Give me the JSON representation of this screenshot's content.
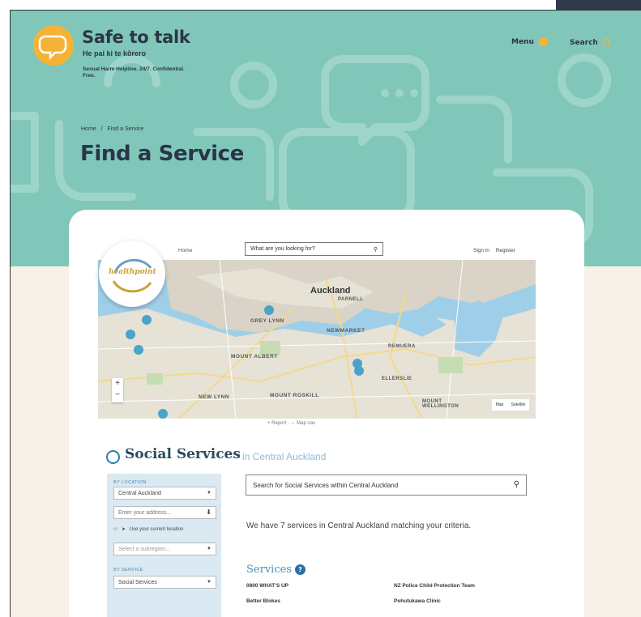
{
  "brand": {
    "name": "Safe to talk",
    "sub": "He pai ki te kōrero",
    "tagline": "Sexual Harm Helpline. 24/7. Confidential. Free."
  },
  "nav": {
    "menu_label": "Menu",
    "search_label": "Search"
  },
  "breadcrumb": {
    "home": "Home",
    "sep": "/",
    "current": "Find a Service"
  },
  "page_title": "Find a Service",
  "healthpoint": {
    "logo_text": "healthpoint",
    "home": "Home",
    "search_placeholder": "What are you looking for?",
    "sign_in": "Sign in",
    "register": "Register",
    "below_map": "+ Report · ⇔ Map nav"
  },
  "map": {
    "labels": [
      "Auckland",
      "PARNELL",
      "GREY LYNN",
      "NEWMARKET",
      "REMUERA",
      "MOUNT ALBERT",
      "ELLERSLIE",
      "NEW LYNN",
      "MOUNT ROSKILL",
      "MOUNT WELLINGTON"
    ],
    "zoom_in": "+",
    "zoom_out": "−",
    "map_btn": "Map",
    "satellite_btn": "Satellite"
  },
  "section": {
    "title": "Social Services",
    "location": "in Central Auckland"
  },
  "filters": {
    "location_label": "BY LOCATION",
    "location_value": "Central Auckland",
    "address_placeholder": "Enter your address...",
    "or": "or",
    "use_location": "Use your current location",
    "subregion_placeholder": "Select a subregion...",
    "service_label": "BY SERVICE",
    "service_value": "Social Services"
  },
  "results": {
    "search_placeholder": "Search for Social Services within Central Auckland",
    "count_text": "We have 7 services in Central Auckland matching your criteria.",
    "services_heading": "Services",
    "services": [
      "0800 WHAT'S UP",
      "Better Blokes",
      "NZ Police Child Protection Team",
      "Pohutukawa Clinic"
    ]
  },
  "colors": {
    "hero": "#80c7b9",
    "accent": "#f5b335",
    "ink": "#2b3548",
    "page_bg": "#f7f1e9"
  }
}
